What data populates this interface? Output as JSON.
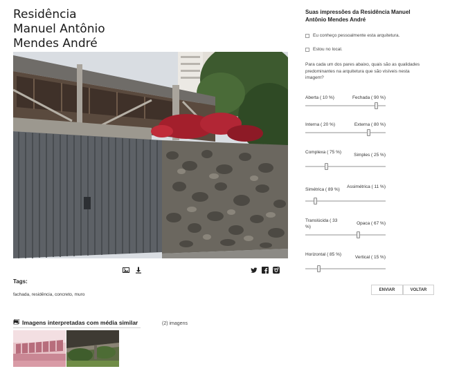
{
  "page": {
    "title_lines": [
      "Residência",
      "Manuel Antônio",
      "Mendes André"
    ]
  },
  "photo_toolbar": {
    "left_icons": [
      "image-icon",
      "download-icon"
    ],
    "share_icons": [
      "twitter-icon",
      "facebook-icon",
      "instagram-icon"
    ]
  },
  "tags": {
    "title": "Tags:",
    "list": "fachada, residência, concreto, muro"
  },
  "similar": {
    "heading": "Imagens interpretadas com média similar",
    "count": "(2) imagens"
  },
  "panel": {
    "title": "Suas impressões da Residência Manuel Antônio Mendes André",
    "checkbox_know": "Eu conheço pessoalmente esta arquitetura.",
    "checkbox_local": "Estou no local.",
    "instructions": "Para cada um dos pares abaixo, quais são as qualidades predominantes na arquitetura que são visíveis nesta imagem?",
    "pairs": [
      {
        "left": "Aberta ( 10 %)",
        "right": "Fechada ( 90 %)",
        "value": 0.9
      },
      {
        "left": "Interna ( 20 %)",
        "right": "Externa ( 80 %)",
        "value": 0.8
      },
      {
        "left": "Complexa ( 75 %)",
        "right": "Simples ( 25 %)",
        "value": 0.25
      },
      {
        "left": "Simétrica ( 89 %)",
        "right": "Assimétrica ( 11 %)",
        "value": 0.11
      },
      {
        "left": "Translúcida ( 33 %)",
        "right": "Opaca ( 67 %)",
        "value": 0.67
      },
      {
        "left": "Horizontal ( 85 %)",
        "right": "Vertical ( 15 %)",
        "value": 0.15
      }
    ],
    "send_label": "ENVIAR",
    "back_label": "VOLTAR"
  }
}
